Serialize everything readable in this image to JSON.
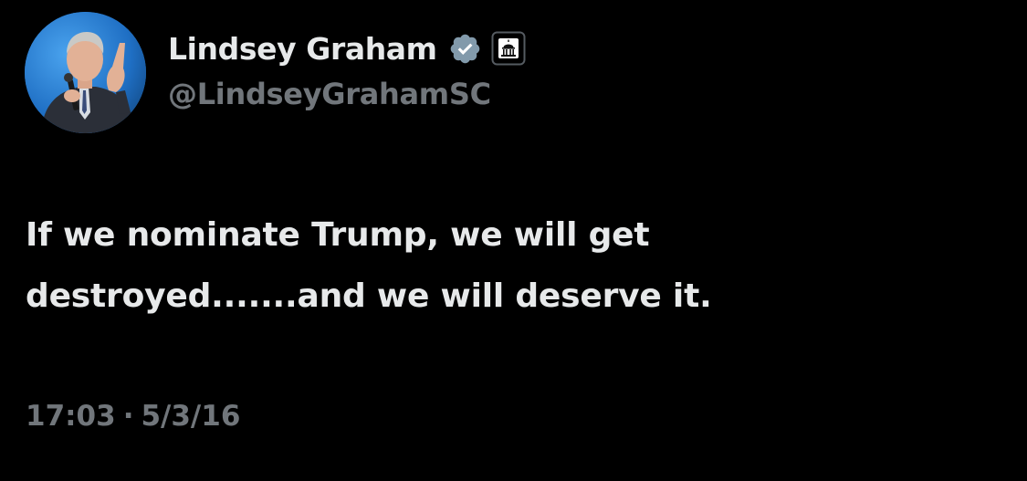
{
  "author": {
    "display_name": "Lindsey Graham",
    "handle": "@LindseyGrahamSC",
    "avatar_icon": "avatar-photo",
    "verified_icon": "verified-badge-icon",
    "affiliation_icon": "government-building-icon"
  },
  "tweet": {
    "text_line_1": "If we nominate Trump, we will get",
    "text_line_2": "destroyed.......and we will deserve it."
  },
  "meta": {
    "time": "17:03",
    "separator": "·",
    "date": "5/3/16"
  },
  "colors": {
    "background": "#000000",
    "primary_text": "#e7e9ea",
    "secondary_text": "#71767b",
    "verified_badge": "#829aab"
  }
}
